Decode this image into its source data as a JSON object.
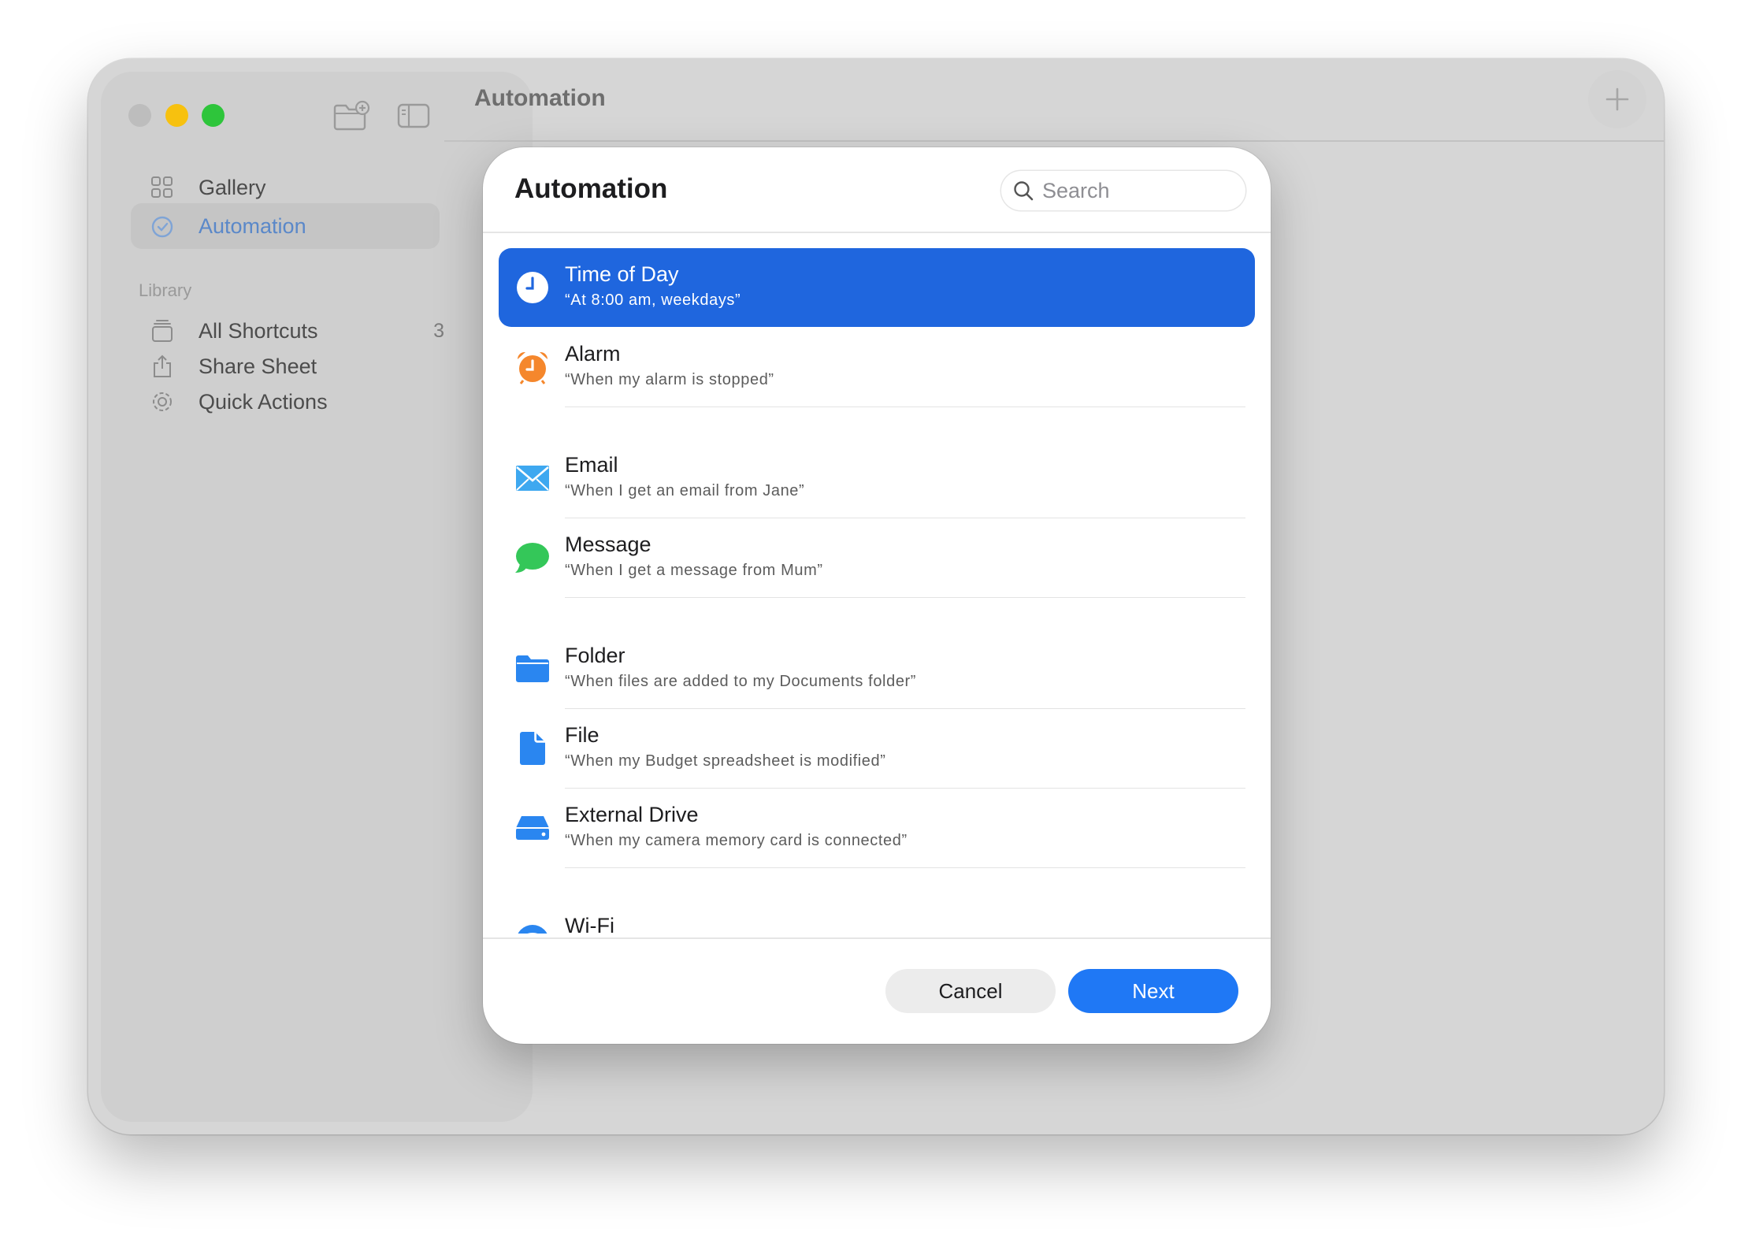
{
  "window": {
    "title": "Automation"
  },
  "sidebar": {
    "items": [
      {
        "label": "Gallery",
        "icon": "grid-icon"
      },
      {
        "label": "Automation",
        "icon": "clock-check-icon",
        "active": true
      }
    ],
    "section_label": "Library",
    "library_items": [
      {
        "label": "All Shortcuts",
        "icon": "stack-icon",
        "count": "3"
      },
      {
        "label": "Share Sheet",
        "icon": "share-icon"
      },
      {
        "label": "Quick Actions",
        "icon": "gear-icon"
      }
    ]
  },
  "modal": {
    "title": "Automation",
    "search_placeholder": "Search",
    "items": [
      {
        "title": "Time of Day",
        "subtitle": "“At 8:00 am, weekdays”",
        "icon": "clock-icon",
        "color": "#ffffff",
        "selected": true
      },
      {
        "title": "Alarm",
        "subtitle": "“When my alarm is stopped”",
        "icon": "alarm-clock-icon",
        "color": "#f5872c"
      },
      {
        "title": "Email",
        "subtitle": "“When I get an email from Jane”",
        "icon": "envelope-icon",
        "color": "#3ea8f0"
      },
      {
        "title": "Message",
        "subtitle": "“When I get a message from Mum”",
        "icon": "message-bubble-icon",
        "color": "#34c759"
      },
      {
        "title": "Folder",
        "subtitle": "“When files are added to my Documents folder”",
        "icon": "folder-icon",
        "color": "#2a86f0"
      },
      {
        "title": "File",
        "subtitle": "“When my Budget spreadsheet is modified”",
        "icon": "document-icon",
        "color": "#2a86f0"
      },
      {
        "title": "External Drive",
        "subtitle": "“When my camera memory card is connected”",
        "icon": "drive-icon",
        "color": "#2a86f0"
      },
      {
        "title": "Wi-Fi",
        "subtitle": "",
        "icon": "wifi-icon",
        "color": "#2a86f0"
      }
    ],
    "cancel_label": "Cancel",
    "next_label": "Next"
  },
  "colors": {
    "accent": "#1f66de",
    "next_button": "#1f78f5"
  }
}
